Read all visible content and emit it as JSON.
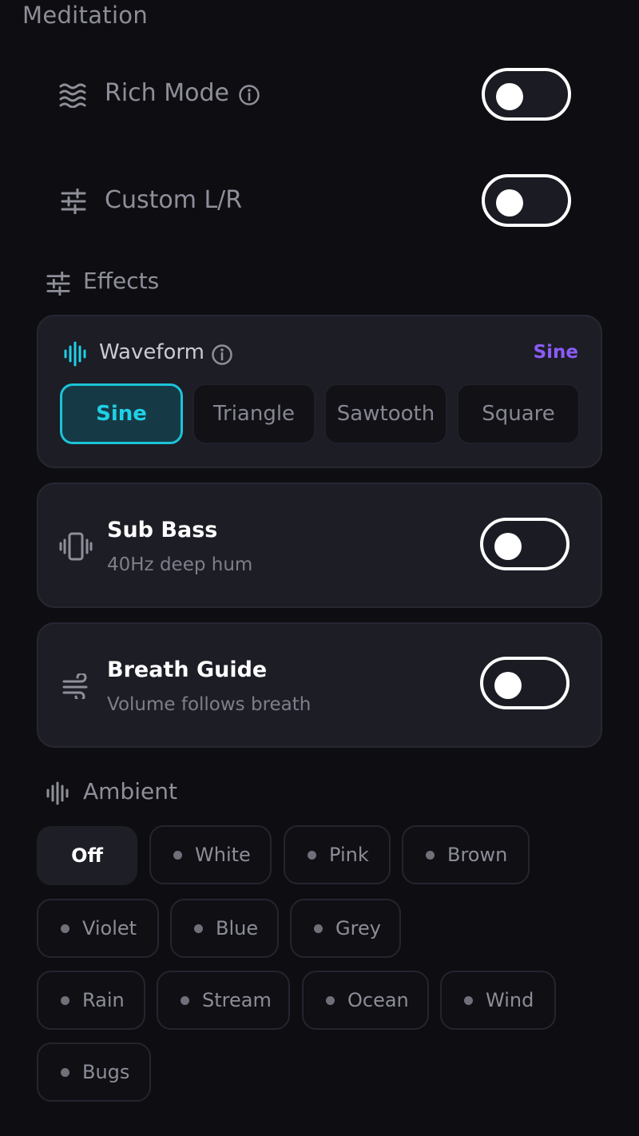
{
  "header": {
    "title": "Meditation"
  },
  "rich_mode": {
    "label": "Rich Mode",
    "enabled": false
  },
  "custom_lr": {
    "label": "Custom L/R",
    "enabled": false
  },
  "effects": {
    "title": "Effects",
    "waveform": {
      "label": "Waveform",
      "current_value": "Sine",
      "options": [
        "Sine",
        "Triangle",
        "Sawtooth",
        "Square"
      ],
      "selected": "Sine"
    },
    "sub_bass": {
      "title": "Sub Bass",
      "subtitle": "40Hz deep hum",
      "enabled": false
    },
    "breath_guide": {
      "title": "Breath Guide",
      "subtitle": "Volume follows breath",
      "enabled": false
    }
  },
  "ambient": {
    "title": "Ambient",
    "selected": "Off",
    "options": [
      "Off",
      "White",
      "Pink",
      "Brown",
      "Violet",
      "Blue",
      "Grey",
      "Rain",
      "Stream",
      "Ocean",
      "Wind",
      "Bugs"
    ]
  },
  "colors": {
    "background": "#0e0e12",
    "card": "#1c1d25",
    "accent_cyan": "#1fd0e6",
    "accent_purple": "#8b5cf6",
    "toggle_border": "#ffffff"
  },
  "icons": {
    "rich_mode": "waves-icon",
    "custom_lr": "sliders-icon",
    "effects": "sliders-icon",
    "waveform": "waveform-icon",
    "sub_bass": "vibrate-icon",
    "breath_guide": "wind-icon",
    "ambient": "audio-bars-icon",
    "info": "info-icon"
  }
}
